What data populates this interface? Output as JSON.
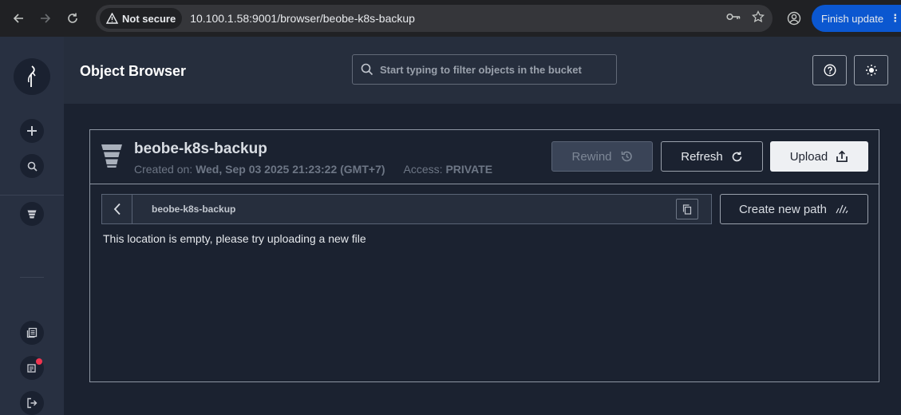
{
  "browser": {
    "security_label": "Not secure",
    "url": "10.100.1.58:9001/browser/beobe-k8s-backup",
    "finish_update_label": "Finish update"
  },
  "header": {
    "title": "Object Browser",
    "search_placeholder": "Start typing to filter objects in the bucket"
  },
  "bucket": {
    "name": "beobe-k8s-backup",
    "created_label": "Created on:",
    "created_value": "Wed, Sep 03 2025 21:23:22 (GMT+7)",
    "access_label": "Access:",
    "access_value": "PRIVATE"
  },
  "actions": {
    "rewind_label": "Rewind",
    "refresh_label": "Refresh",
    "upload_label": "Upload",
    "create_path_label": "Create new path"
  },
  "path": {
    "current": "beobe-k8s-backup"
  },
  "content": {
    "empty_message": "This location is empty, please try uploading a new file"
  },
  "colors": {
    "accent_blue": "#0b57d0",
    "notification_dot": "#f0344f"
  }
}
